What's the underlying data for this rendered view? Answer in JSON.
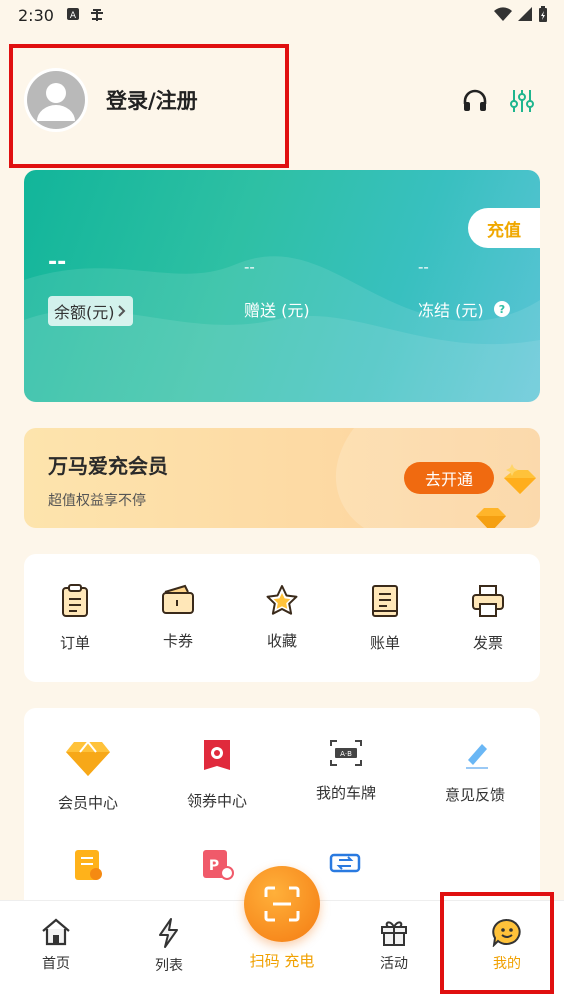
{
  "status": {
    "time": "2:30"
  },
  "profile": {
    "name": "登录/注册"
  },
  "wallet": {
    "recharge": "充值",
    "balance_value": "--",
    "balance_label": "余额(元)",
    "gift_value": "--",
    "gift_label": "赠送 (元)",
    "frozen_value": "--",
    "frozen_label": "冻结 (元)"
  },
  "vip": {
    "title": "万马爱充会员",
    "subtitle": "超值权益享不停",
    "button": "去开通"
  },
  "quick": {
    "items": [
      {
        "label": "订单",
        "icon": "clipboard-icon"
      },
      {
        "label": "卡券",
        "icon": "wallet-icon"
      },
      {
        "label": "收藏",
        "icon": "star-icon"
      },
      {
        "label": "账单",
        "icon": "ledger-icon"
      },
      {
        "label": "发票",
        "icon": "printer-icon"
      }
    ]
  },
  "services": {
    "items": [
      {
        "label": "会员中心",
        "icon": "diamond-icon"
      },
      {
        "label": "领券中心",
        "icon": "coupon-icon"
      },
      {
        "label": "我的车牌",
        "icon": "license-plate-icon"
      },
      {
        "label": "意见反馈",
        "icon": "feedback-icon"
      },
      {
        "label": "",
        "icon": "document-icon"
      },
      {
        "label": "",
        "icon": "parking-icon"
      },
      {
        "label": "",
        "icon": "v2g-icon"
      }
    ]
  },
  "tabs": [
    {
      "label": "首页",
      "icon": "home-icon"
    },
    {
      "label": "列表",
      "icon": "bolt-icon"
    },
    {
      "label": "扫码 充电",
      "icon": "scan-icon"
    },
    {
      "label": "活动",
      "icon": "gift-icon"
    },
    {
      "label": "我的",
      "icon": "smile-icon"
    }
  ],
  "colors": {
    "accent": "#f47b12",
    "teal": "#12b59a",
    "highlight": "#e01010",
    "mine": "#f0a000"
  }
}
